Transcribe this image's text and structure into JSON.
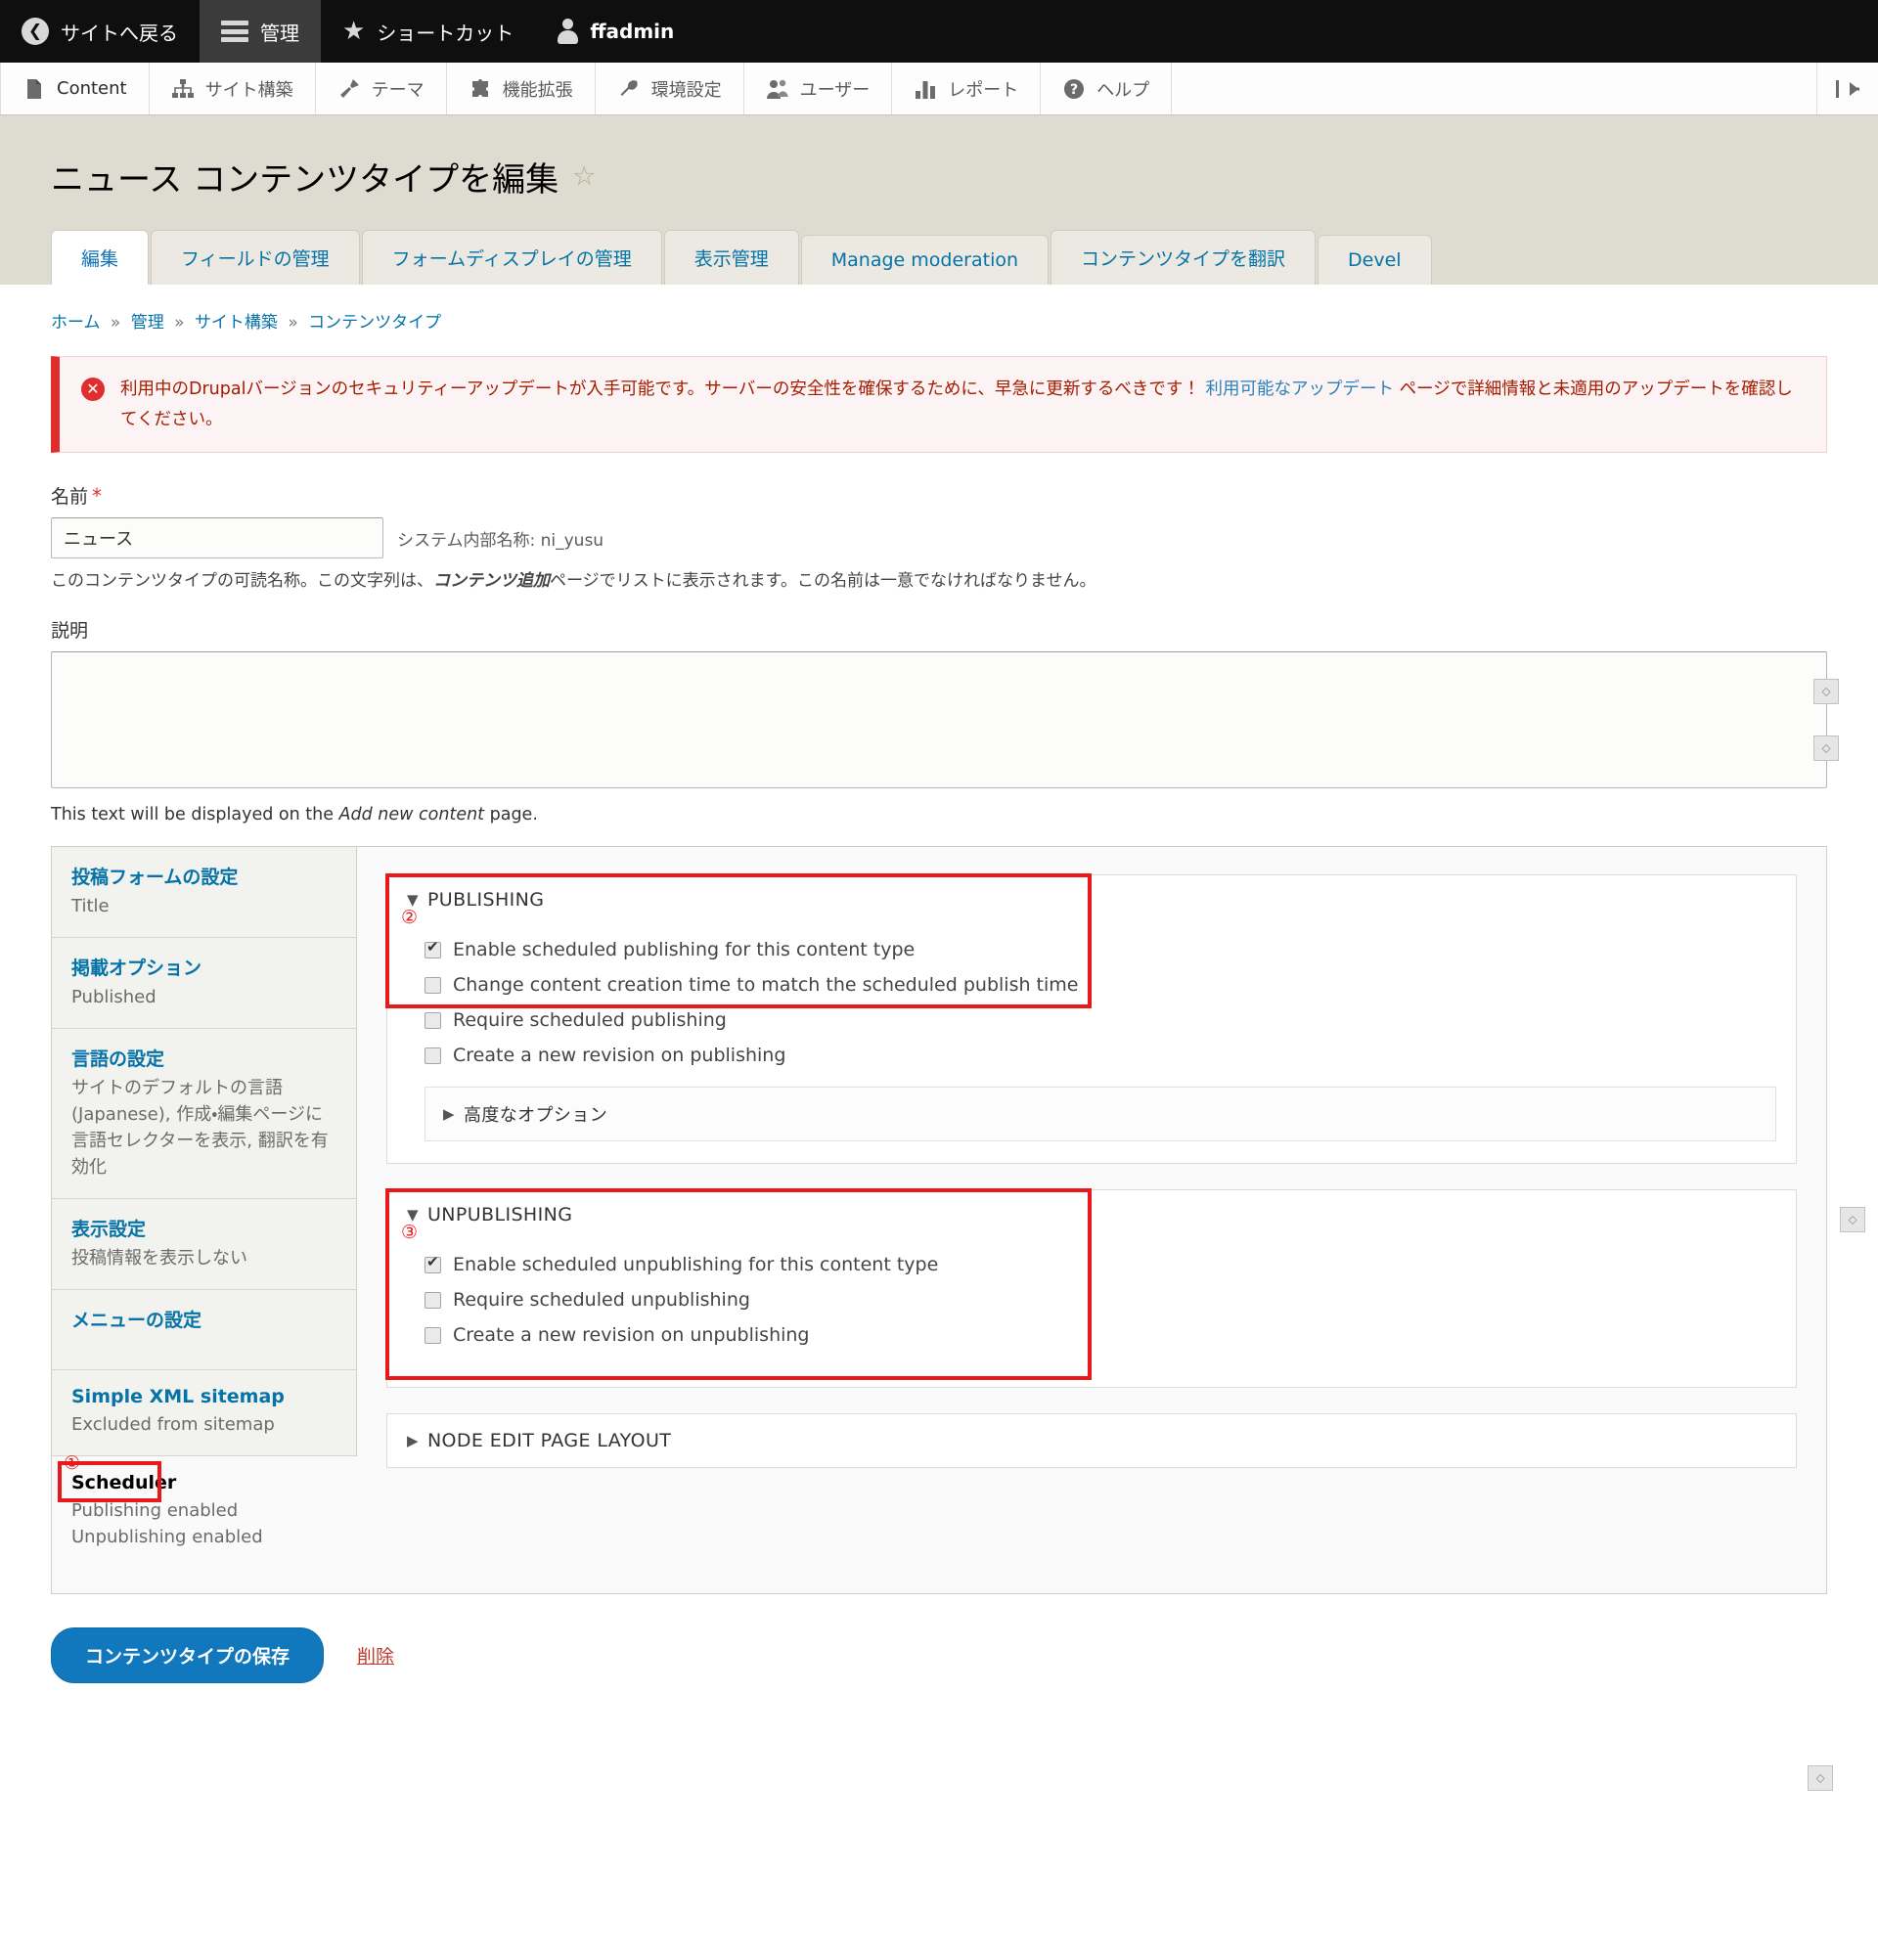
{
  "toolbar": {
    "back_to_site": "サイトへ戻る",
    "manage": "管理",
    "shortcuts": "ショートカット",
    "user": "ffadmin"
  },
  "menu": {
    "items": [
      {
        "label": "Content",
        "icon": "document-icon"
      },
      {
        "label": "サイト構築",
        "icon": "sitemap-icon"
      },
      {
        "label": "テーマ",
        "icon": "brush-icon"
      },
      {
        "label": "機能拡張",
        "icon": "puzzle-icon"
      },
      {
        "label": "環境設定",
        "icon": "wrench-icon"
      },
      {
        "label": "ユーザー",
        "icon": "people-icon"
      },
      {
        "label": "レポート",
        "icon": "bar-chart-icon"
      },
      {
        "label": "ヘルプ",
        "icon": "question-icon"
      }
    ],
    "collapse_label": "|←"
  },
  "page": {
    "title": "ニュース コンテンツタイプを編集",
    "star": "☆"
  },
  "tabs": [
    {
      "label": "編集",
      "active": true
    },
    {
      "label": "フィールドの管理",
      "active": false
    },
    {
      "label": "フォームディスプレイの管理",
      "active": false
    },
    {
      "label": "表示管理",
      "active": false
    },
    {
      "label": "Manage moderation",
      "active": false
    },
    {
      "label": "コンテンツタイプを翻訳",
      "active": false
    },
    {
      "label": "Devel",
      "active": false
    }
  ],
  "breadcrumb": [
    "ホーム",
    "管理",
    "サイト構築",
    "コンテンツタイプ"
  ],
  "breadcrumb_sep": "»",
  "error": {
    "icon": "error-icon",
    "text_before": "利用中のDrupalバージョンのセキュリティーアップデートが入手可能です。サーバーの安全性を確保するために、早急に更新するべきです！",
    "link": "利用可能なアップデート",
    "text_after": "ページで詳細情報と未適用のアップデートを確認してください。"
  },
  "form": {
    "name_label": "名前",
    "name_required": "*",
    "name_value": "ニュース",
    "machine_name": "システム内部名称: ni_yusu",
    "name_help_1": "このコンテンツタイプの可読名称。この文字列は、",
    "name_help_bold": "コンテンツ追加",
    "name_help_2": "ページでリストに表示されます。この名前は一意でなければなりません。",
    "desc_label": "説明",
    "desc_value": "",
    "desc_help_1": "This text will be displayed on the ",
    "desc_help_italic": "Add new content",
    "desc_help_2": " page."
  },
  "vertical_tabs": [
    {
      "title": "投稿フォームの設定",
      "summary": "Title",
      "selected": false
    },
    {
      "title": "掲載オプション",
      "summary": "Published",
      "selected": false
    },
    {
      "title": "言語の設定",
      "summary": "サイトのデフォルトの言語 (Japanese), 作成・編集ページに言語セレクターを表示, 翻訳を有効化",
      "selected": false
    },
    {
      "title": "表示設定",
      "summary": "投稿情報を表示しない",
      "selected": false
    },
    {
      "title": "メニューの設定",
      "summary": "",
      "selected": false
    },
    {
      "title": "Simple XML sitemap",
      "summary": "Excluded from sitemap",
      "selected": false
    },
    {
      "title": "Scheduler",
      "summary": "Publishing enabled\nUnpublishing enabled",
      "selected": true
    }
  ],
  "scheduler": {
    "publishing": {
      "legend": "PUBLISHING",
      "triangle": "▼",
      "checkboxes": [
        {
          "label": "Enable scheduled publishing for this content type",
          "checked": true
        },
        {
          "label": "Change content creation time to match the scheduled publish time",
          "checked": false
        },
        {
          "label": "Require scheduled publishing",
          "checked": false
        },
        {
          "label": "Create a new revision on publishing",
          "checked": false
        }
      ],
      "advanced_label": "高度なオプション",
      "advanced_triangle": "▶"
    },
    "unpublishing": {
      "legend": "UNPUBLISHING",
      "triangle": "▼",
      "checkboxes": [
        {
          "label": "Enable scheduled unpublishing for this content type",
          "checked": true
        },
        {
          "label": "Require scheduled unpublishing",
          "checked": false
        },
        {
          "label": "Create a new revision on unpublishing",
          "checked": false
        }
      ]
    },
    "node_edit_layout": {
      "legend": "NODE EDIT PAGE LAYOUT",
      "triangle": "▶"
    }
  },
  "annotations": [
    {
      "number": "①",
      "target": "scheduler-vertical-tab"
    },
    {
      "number": "②",
      "target": "publishing-section"
    },
    {
      "number": "③",
      "target": "unpublishing-section"
    }
  ],
  "actions": {
    "save_label": "コンテンツタイプの保存",
    "delete_label": "削除"
  },
  "colors": {
    "accent_blue": "#1278bd",
    "link_blue": "#0673a8",
    "error_red": "#e02e2e",
    "annotation_red": "#e8191b",
    "header_bg": "#dedbd1",
    "toolbar_bg": "#0f0f0f"
  }
}
